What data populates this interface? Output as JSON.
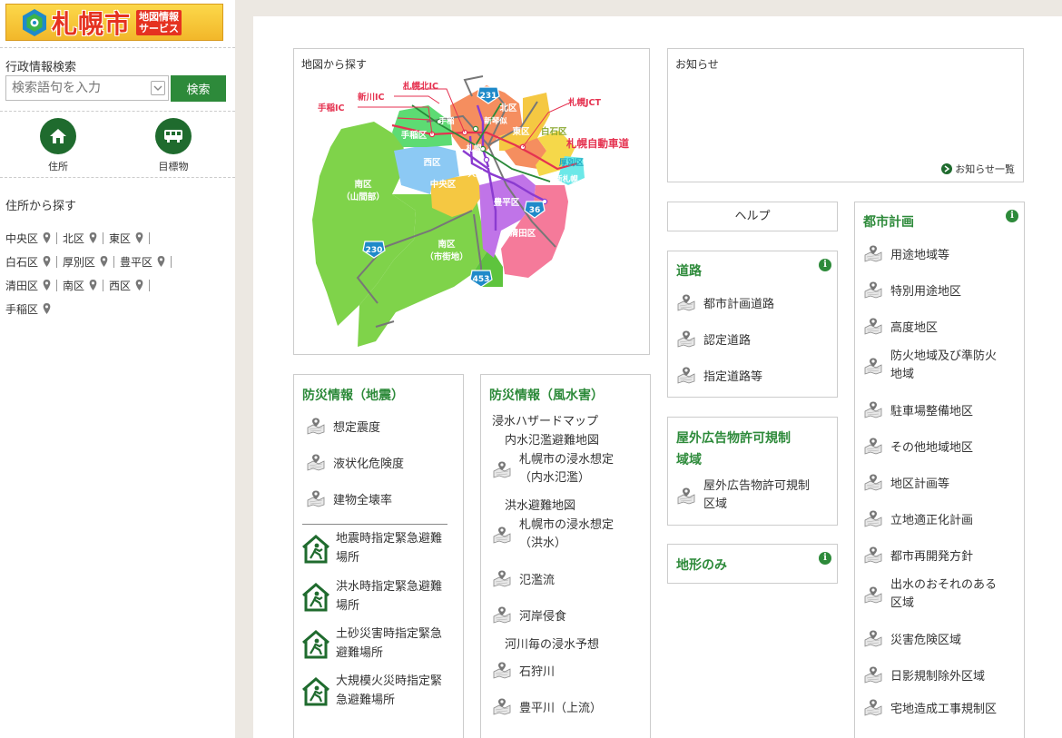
{
  "logo": {
    "name": "札幌市",
    "tag_line1": "地図情報",
    "tag_line2": "サービス"
  },
  "search": {
    "label": "行政情報検索",
    "placeholder": "検索語句を入力",
    "button": "検索"
  },
  "quick": [
    {
      "label": "住所",
      "icon": "house-icon"
    },
    {
      "label": "目標物",
      "icon": "bus-icon"
    }
  ],
  "address": {
    "title": "住所から探す",
    "wards": [
      "中央区",
      "北区",
      "東区",
      "白石区",
      "厚別区",
      "豊平区",
      "清田区",
      "南区",
      "西区",
      "手稲区"
    ]
  },
  "map_panel": {
    "title": "地図から探す",
    "labels": {
      "teine_ic": "手稲IC",
      "shinkawa_ic": "新川IC",
      "kita_ic": "札幌北IC",
      "jct": "札幌JCT",
      "expressway": "札幌自動車道",
      "kita": "北区",
      "higashi": "東区",
      "shiroishi": "白石区",
      "teine": "手稲区",
      "nishi": "西区",
      "chuo": "中央区",
      "atsubetsu": "厚別区",
      "toyohira": "豊平区",
      "kiyota": "清田区",
      "minami_mt1": "南区",
      "minami_mt2": "（山間部）",
      "minami_city1": "南区",
      "minami_city2": "（市街地）",
      "st_teine": "手稲",
      "st_shinkotoni": "新琴似",
      "st_sapporo": "札幌",
      "st_odori": "大通",
      "st_shinsapporo": "新札幌",
      "r231": "231",
      "r230": "230",
      "r453": "453",
      "r36": "36"
    }
  },
  "news": {
    "title": "お知らせ",
    "link": "お知らせ一覧"
  },
  "help": {
    "label": "ヘルプ"
  },
  "road": {
    "title": "道路",
    "items": [
      "都市計画道路",
      "認定道路",
      "指定道路等"
    ]
  },
  "outdoor_ad": {
    "title_line1": "屋外広告物許可規制",
    "title_line2": "域域",
    "item_line1": "屋外広告物許可規制",
    "item_line2": "区域"
  },
  "terrain": {
    "title": "地形のみ"
  },
  "city_plan": {
    "title": "都市計画",
    "items": [
      [
        "用途地域等"
      ],
      [
        "特別用途地区"
      ],
      [
        "高度地区"
      ],
      [
        "防火地域及び準防火",
        "地域"
      ],
      [
        "駐車場整備地区"
      ],
      [
        "その他地域地区"
      ],
      [
        "地区計画等"
      ],
      [
        "立地適正化計画"
      ],
      [
        "都市再開発方針"
      ],
      [
        "出水のおそれのある",
        "区域"
      ],
      [
        "災害危険区域"
      ],
      [
        "日影規制除外区域"
      ],
      [
        "宅地造成工事規制区"
      ]
    ]
  },
  "quake": {
    "title": "防災情報（地震）",
    "items": [
      "想定震度",
      "液状化危険度",
      "建物全壊率"
    ],
    "evac": [
      [
        "地震時指定緊急避難",
        "場所"
      ],
      [
        "洪水時指定緊急避難",
        "場所"
      ],
      [
        "土砂災害時指定緊急",
        "避難場所"
      ],
      [
        "大規模火災時指定緊",
        "急避難場所"
      ]
    ]
  },
  "flood": {
    "title": "防災情報（風水害）",
    "hazard_map": "浸水ハザードマップ",
    "inland_map": "内水氾濫避難地図",
    "inland_item": [
      "札幌市の浸水想定",
      "（内水氾濫）"
    ],
    "flood_map": "洪水避難地図",
    "flood_item": [
      "札幌市の浸水想定",
      "（洪水）"
    ],
    "items": [
      "氾濫流",
      "河岸侵食"
    ],
    "river_forecast": "河川毎の浸水予想",
    "rivers": [
      "石狩川",
      "豊平川（上流）"
    ]
  },
  "colors": {
    "green": "#2d8a3a",
    "dark_green": "#1f6b2e",
    "red": "#e53220"
  }
}
